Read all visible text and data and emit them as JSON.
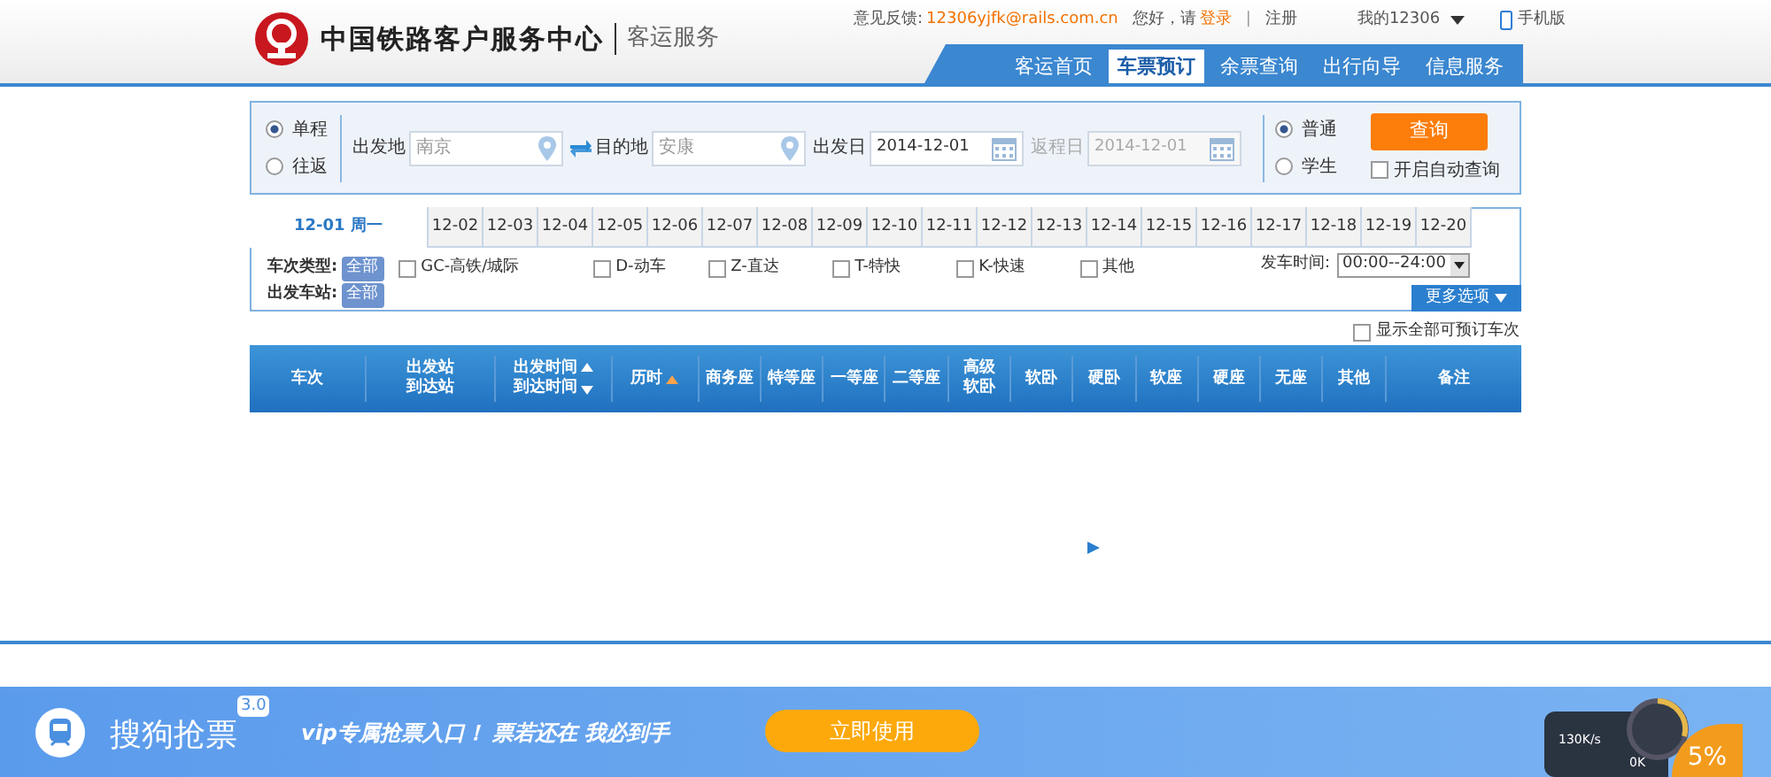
{
  "header": {
    "logo_title": "中国铁路客户服务中心",
    "logo_subtitle": "客运服务",
    "feedback_label": "意见反馈:",
    "feedback_email": "12306yjfk@rails.com.cn",
    "greeting": "您好，请",
    "login": "登录",
    "separator": "|",
    "register": "注册",
    "my_account": "我的12306",
    "mobile": "手机版"
  },
  "nav": [
    {
      "label": "客运首页",
      "selected": false
    },
    {
      "label": "车票预订",
      "selected": true
    },
    {
      "label": "余票查询",
      "selected": false
    },
    {
      "label": "出行向导",
      "selected": false
    },
    {
      "label": "信息服务",
      "selected": false
    }
  ],
  "search": {
    "trip_types": [
      {
        "label": "单程",
        "selected": true
      },
      {
        "label": "往返",
        "selected": false
      }
    ],
    "from_label": "出发地",
    "from_value": "南京",
    "to_label": "目的地",
    "to_value": "安康",
    "depart_label": "出发日",
    "depart_value": "2014-12-01",
    "return_label": "返程日",
    "return_value": "2014-12-01",
    "return_disabled": true,
    "passenger_types": [
      {
        "label": "普通",
        "selected": true
      },
      {
        "label": "学生",
        "selected": false
      }
    ],
    "query_button": "查询",
    "auto_query": {
      "label": "开启自动查询",
      "checked": false
    }
  },
  "dates": [
    {
      "label": "12-01 周一",
      "selected": true
    },
    {
      "label": "12-02",
      "selected": false
    },
    {
      "label": "12-03",
      "selected": false
    },
    {
      "label": "12-04",
      "selected": false
    },
    {
      "label": "12-05",
      "selected": false
    },
    {
      "label": "12-06",
      "selected": false
    },
    {
      "label": "12-07",
      "selected": false
    },
    {
      "label": "12-08",
      "selected": false
    },
    {
      "label": "12-09",
      "selected": false
    },
    {
      "label": "12-10",
      "selected": false
    },
    {
      "label": "12-11",
      "selected": false
    },
    {
      "label": "12-12",
      "selected": false
    },
    {
      "label": "12-13",
      "selected": false
    },
    {
      "label": "12-14",
      "selected": false
    },
    {
      "label": "12-15",
      "selected": false
    },
    {
      "label": "12-16",
      "selected": false
    },
    {
      "label": "12-17",
      "selected": false
    },
    {
      "label": "12-18",
      "selected": false
    },
    {
      "label": "12-19",
      "selected": false
    },
    {
      "label": "12-20",
      "selected": false
    }
  ],
  "filters": {
    "train_type_label": "车次类型:",
    "train_type_all": "全部",
    "train_types": [
      {
        "label": "GC-高铁/城际",
        "checked": false
      },
      {
        "label": "D-动车",
        "checked": false
      },
      {
        "label": "Z-直达",
        "checked": false
      },
      {
        "label": "T-特快",
        "checked": false
      },
      {
        "label": "K-快速",
        "checked": false
      },
      {
        "label": "其他",
        "checked": false
      }
    ],
    "station_label": "出发车站:",
    "station_all": "全部",
    "time_label": "发车时间:",
    "time_value": "00:00--24:00",
    "more_options": "更多选项"
  },
  "show_all": {
    "label": "显示全部可预订车次",
    "checked": false
  },
  "table": {
    "columns": [
      {
        "lines": [
          "车次"
        ]
      },
      {
        "lines": [
          "出发站",
          "到达站"
        ]
      },
      {
        "lines": [
          "出发时间",
          "到达时间"
        ],
        "kind": "sortable"
      },
      {
        "lines": [
          "历时"
        ],
        "kind": "sorted"
      },
      {
        "lines": [
          "商务座"
        ]
      },
      {
        "lines": [
          "特等座"
        ]
      },
      {
        "lines": [
          "一等座"
        ]
      },
      {
        "lines": [
          "二等座"
        ]
      },
      {
        "lines": [
          "高级",
          "软卧"
        ]
      },
      {
        "lines": [
          "软卧"
        ]
      },
      {
        "lines": [
          "硬卧"
        ]
      },
      {
        "lines": [
          "软座"
        ]
      },
      {
        "lines": [
          "硬座"
        ]
      },
      {
        "lines": [
          "无座"
        ]
      },
      {
        "lines": [
          "其他"
        ]
      },
      {
        "lines": [
          "备注"
        ]
      }
    ]
  },
  "banner": {
    "app_name": "搜狗抢票",
    "version": "3.0",
    "slogan_1": "vip专属抢票入口！",
    "slogan_2": "票若还在 我必到手",
    "button": "立即使用"
  },
  "speed_widget": {
    "upload": "130K/s",
    "download": "0K",
    "percent": "5%"
  }
}
